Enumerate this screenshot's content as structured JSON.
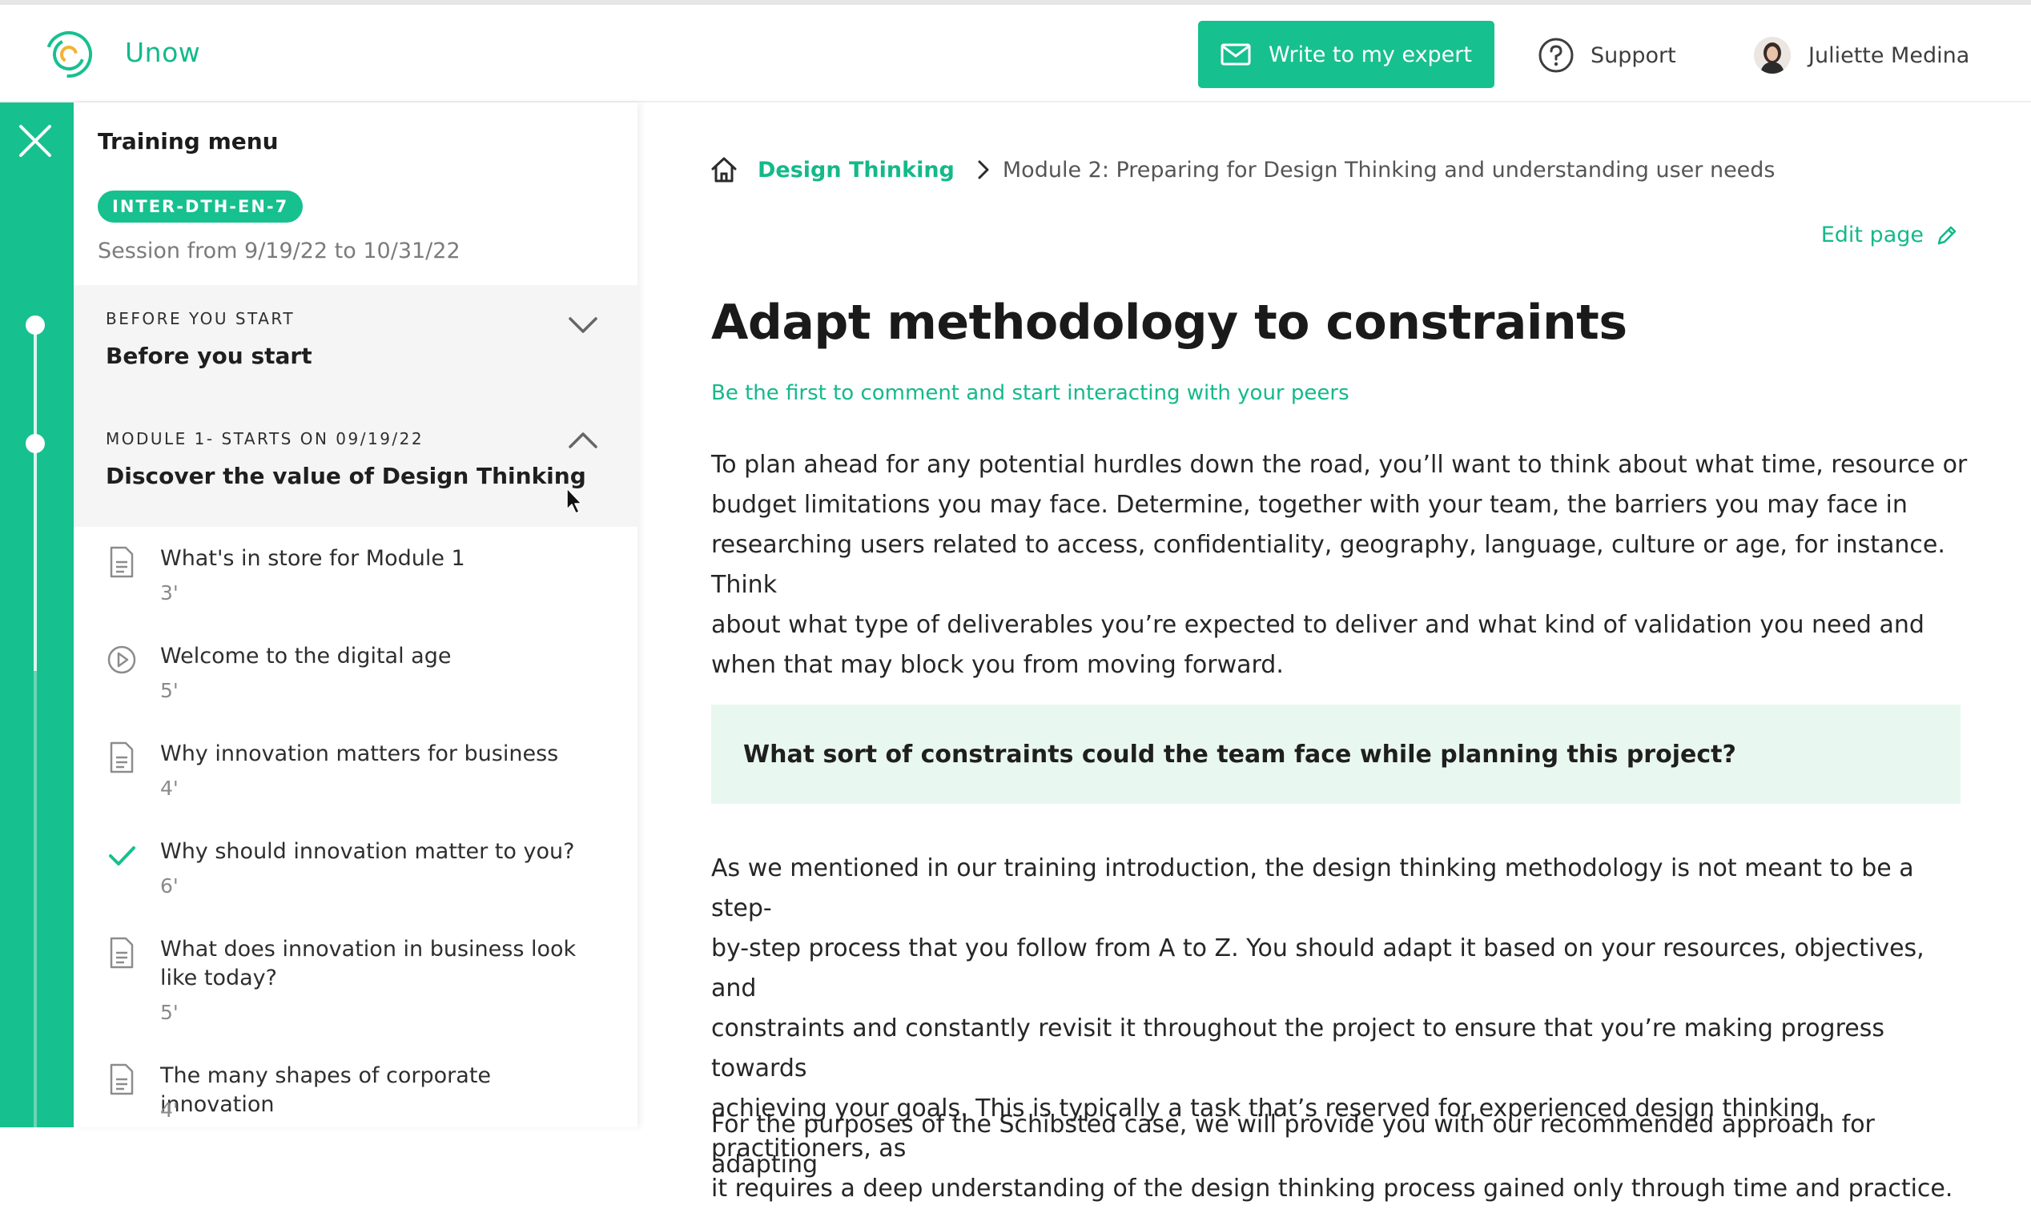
{
  "header": {
    "brand": "Unow",
    "cta_label": "Write to my expert",
    "support_label": "Support",
    "user_name": "Juliette Medina"
  },
  "sidebar": {
    "title": "Training menu",
    "session_code": "INTER-DTH-EN-7",
    "session_dates": "Session from 9/19/22 to 10/31/22",
    "sections": [
      {
        "label": "BEFORE YOU START",
        "title": "Before you start",
        "expanded": false
      },
      {
        "label": "MODULE 1- STARTS ON 09/19/22",
        "title": "Discover the value of Design Thinking",
        "expanded": true
      }
    ],
    "lessons": [
      {
        "title": "What's in store for Module 1",
        "duration": "3'",
        "icon": "document-icon"
      },
      {
        "title": "Welcome to the digital age",
        "duration": "5'",
        "icon": "play-icon"
      },
      {
        "title": "Why innovation matters for business",
        "duration": "4'",
        "icon": "document-icon"
      },
      {
        "title": "Why should innovation matter to you?",
        "duration": "6'",
        "icon": "check-icon"
      },
      {
        "title": "What does innovation in business look like today?",
        "duration": "5'",
        "icon": "document-icon"
      },
      {
        "title": "The many shapes of corporate innovation",
        "duration": "4'",
        "icon": "document-icon"
      }
    ]
  },
  "main": {
    "breadcrumb": {
      "course": "Design Thinking",
      "module": "Module 2: Preparing for Design Thinking and understanding user needs"
    },
    "edit_label": "Edit page",
    "title": "Adapt methodology to constraints",
    "comment_link": "Be the first to comment and start interacting with your peers",
    "paragraph_1_lines": [
      "To plan ahead for any potential hurdles down the road, you’ll want to think about what time, resource or",
      "budget limitations you may face. Determine, together with your team, the barriers you may face in",
      "researching users related to access, confidentiality, geography, language, culture or age, for instance. Think",
      "about what type of deliverables you’re expected to deliver and what kind of validation you need and",
      "when that may block you from moving forward."
    ],
    "callout": "What sort of constraints could the team face while planning this project?",
    "paragraph_2_lines": [
      "As we mentioned in our training introduction, the design thinking methodology is not meant to be a step-",
      "by-step process that you follow from A to Z. You should adapt it based on your resources, objectives, and",
      "constraints and constantly revisit it throughout the project to ensure that you’re making progress towards",
      "achieving your goals. This is typically a task that’s reserved for experienced design thinking practitioners, as",
      "it requires a deep understanding of the design thinking process gained only through time and practice."
    ],
    "paragraph_3_partial": "For the purposes of the Schibsted case, we will provide you with our recommended approach for adapting"
  },
  "colors": {
    "accent": "#17c08f",
    "accent_text": "#14b98a",
    "callout_bg": "#e9f7f1",
    "section_bg": "#f5f5f5"
  }
}
